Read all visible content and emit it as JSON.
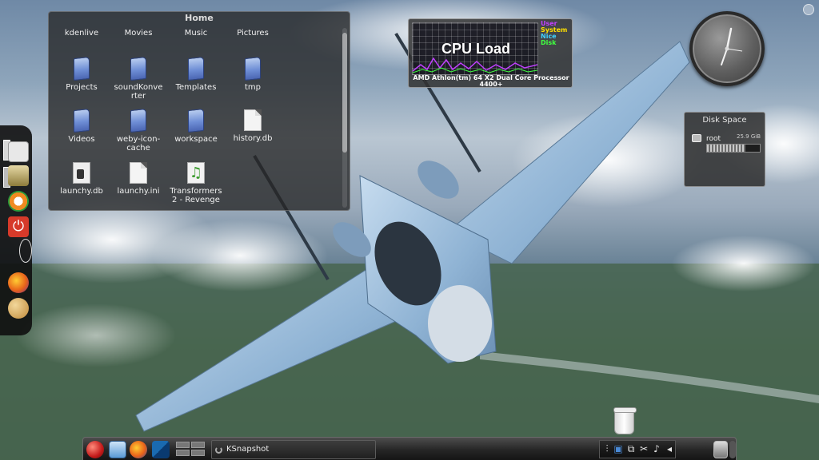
{
  "folder_view": {
    "title": "Home",
    "top_items": [
      "kdenlive",
      "Movies",
      "Music",
      "Pictures"
    ],
    "items": [
      {
        "label": "Projects",
        "icon": "folder-icon"
      },
      {
        "label": "soundKonverter",
        "icon": "folder-icon"
      },
      {
        "label": "Templates",
        "icon": "folder-icon"
      },
      {
        "label": "tmp",
        "icon": "folder-icon"
      },
      {
        "label": "Videos",
        "icon": "folder-icon"
      },
      {
        "label": "weby-icon-cache",
        "icon": "folder-icon"
      },
      {
        "label": "workspace",
        "icon": "folder-icon"
      },
      {
        "label": "history.db",
        "icon": "file-icon"
      },
      {
        "label": "launchy.db",
        "icon": "database-file-icon"
      },
      {
        "label": "launchy.ini",
        "icon": "file-icon"
      },
      {
        "label": "Transformers 2 - Revenge",
        "icon": "music-file-icon"
      }
    ]
  },
  "cpu_widget": {
    "title": "CPU Load",
    "legend": [
      {
        "label": "User",
        "color": "#c040ff"
      },
      {
        "label": "System",
        "color": "#ffe000"
      },
      {
        "label": "Nice",
        "color": "#40d0ff"
      },
      {
        "label": "Disk",
        "color": "#40ff40"
      }
    ],
    "processor": "AMD Athlon(tm) 64 X2 Dual Core Processor 4400+"
  },
  "disk_widget": {
    "title": "Disk Space",
    "drive_label": "root",
    "size": "25.9 GiB",
    "used_fraction": 0.72
  },
  "taskbar": {
    "active_task": "KSnapshot"
  },
  "colors": {
    "panel_bg": "#262626",
    "folder_blue": "#6f8fd6",
    "power_red": "#d63a2a"
  }
}
